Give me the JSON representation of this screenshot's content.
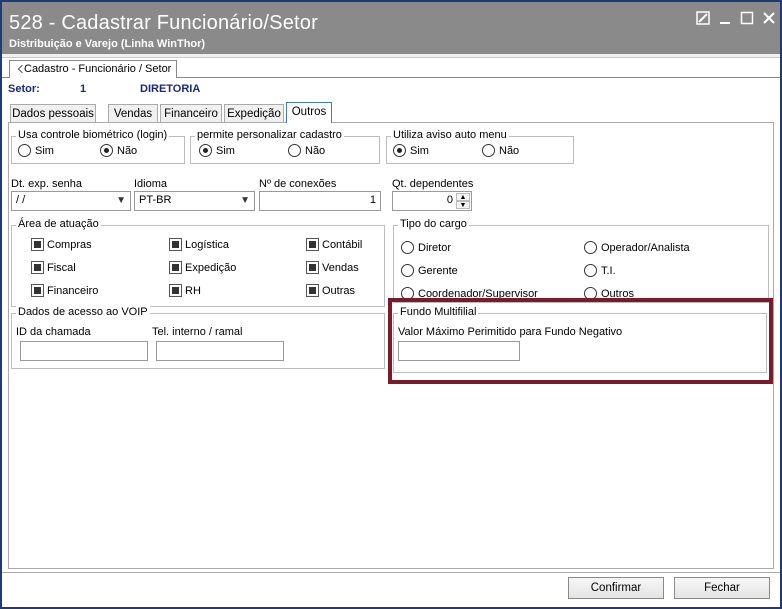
{
  "window": {
    "title": "528 - Cadastrar Funcionário/Setor",
    "subtitle": "Distribuição e Varejo (Linha WinThor)"
  },
  "main_tab": {
    "label": "Cadastro - Funcionário / Setor"
  },
  "setor": {
    "label": "Setor:",
    "code": "1",
    "name": "DIRETORIA"
  },
  "tabs": [
    "Dados pessoais",
    "Vendas",
    "Financeiro",
    "Expedição",
    "Outros"
  ],
  "active_tab": "Outros",
  "biometrico": {
    "title": "Usa controle biométrico (login)",
    "opt1": "Sim",
    "opt2": "Não",
    "selected": "Não"
  },
  "personalizar": {
    "title": "permite personalizar cadastro",
    "opt1": "Sim",
    "opt2": "Não",
    "selected": "Sim"
  },
  "aviso_menu": {
    "title": "Utiliza aviso auto menu",
    "opt1": "Sim",
    "opt2": "Não",
    "selected": "Sim"
  },
  "dt_exp_senha": {
    "label": "Dt. exp. senha",
    "value": " / /"
  },
  "idioma": {
    "label": "Idioma",
    "value": "PT-BR"
  },
  "conexoes": {
    "label": "Nº de conexões",
    "value": "1"
  },
  "dependentes": {
    "label": "Qt. dependentes",
    "value": "0"
  },
  "area_atuacao": {
    "title": "Área de atuação",
    "items": [
      {
        "label": "Compras",
        "checked": true
      },
      {
        "label": "Logística",
        "checked": true
      },
      {
        "label": "Contábil",
        "checked": true
      },
      {
        "label": "Fiscal",
        "checked": true
      },
      {
        "label": "Expedição",
        "checked": true
      },
      {
        "label": "Vendas",
        "checked": true
      },
      {
        "label": "Financeiro",
        "checked": true
      },
      {
        "label": "RH",
        "checked": true
      },
      {
        "label": "Outras",
        "checked": true
      }
    ]
  },
  "tipo_cargo": {
    "title": "Tipo do cargo",
    "options": [
      "Diretor",
      "Operador/Analista",
      "Gerente",
      "T.I.",
      "Coordenador/Supervisor",
      "Outros"
    ]
  },
  "voip": {
    "title": "Dados de acesso ao VOIP",
    "id_label": "ID da chamada",
    "tel_label": "Tel. interno / ramal",
    "id_value": "",
    "tel_value": ""
  },
  "fundo": {
    "title": "Fundo Multifilial",
    "label": "Valor Máximo Perimitido para Fundo Negativo",
    "value": ""
  },
  "buttons": {
    "confirm": "Confirmar",
    "close": "Fechar"
  },
  "highlight_color": "#7b1a28"
}
